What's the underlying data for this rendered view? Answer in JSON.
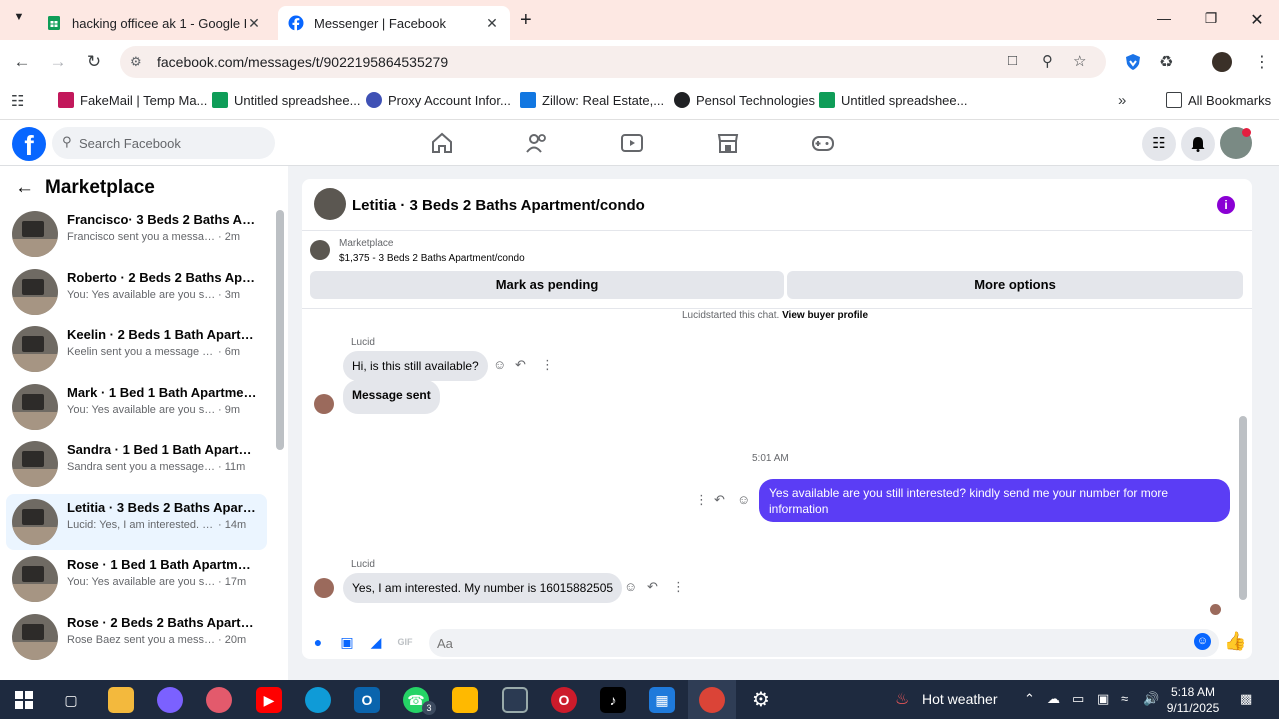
{
  "browser": {
    "tabs": [
      {
        "title": "hacking officee ak 1 - Google D",
        "icon": "sheets-icon",
        "active": false
      },
      {
        "title": "Messenger | Facebook",
        "icon": "facebook-icon",
        "active": true
      }
    ],
    "url": "facebook.com/messages/t/9022195864535279",
    "bookmarks": [
      {
        "label": "FakeMail | Temp Ma...",
        "icon": "fakemail-icon"
      },
      {
        "label": "Untitled spreadshee...",
        "icon": "sheets-icon"
      },
      {
        "label": "Proxy Account Infor...",
        "icon": "proxy-icon"
      },
      {
        "label": "Zillow: Real Estate,...",
        "icon": "zillow-icon"
      },
      {
        "label": "Pensol Technologies",
        "icon": "pensol-icon"
      },
      {
        "label": "Untitled spreadshee...",
        "icon": "sheets-icon"
      }
    ],
    "all_bookmarks": "All Bookmarks",
    "colors": {
      "tabbar": "#fde8e3",
      "sheets": "#0f9d58",
      "facebook": "#0866ff"
    }
  },
  "fb": {
    "search_placeholder": "Search Facebook",
    "nav_icons": [
      "home-icon",
      "friends-icon",
      "video-icon",
      "marketplace-icon",
      "gaming-icon"
    ]
  },
  "sidebar": {
    "title": "Marketplace",
    "conversations": [
      {
        "title": "Francisco· 3 Beds 2 Baths Apart...",
        "preview": "Francisco sent you a message abo...",
        "time": "· 2m",
        "selected": false
      },
      {
        "title": "Roberto · 2 Beds 2 Baths Apart...",
        "preview": "You: Yes available are you still inte...",
        "time": "· 3m",
        "selected": false
      },
      {
        "title": "Keelin · 2 Beds 1 Bath Apartmen...",
        "preview": "Keelin sent you a message about ...",
        "time": "· 6m",
        "selected": false
      },
      {
        "title": "Mark · 1 Bed 1 Bath Apartment/...",
        "preview": "You: Yes available are you still inte...",
        "time": "· 9m",
        "selected": false
      },
      {
        "title": "Sandra · 1 Bed 1 Bath Apartmen...",
        "preview": "Sandra sent you a message abou...",
        "time": "· 11m",
        "selected": false
      },
      {
        "title": "Letitia · 3 Beds 2 Baths Apartme...",
        "preview": "Lucid: Yes, I am interested. My n...",
        "time": "· 14m",
        "selected": true
      },
      {
        "title": "Rose · 1 Bed 1 Bath Apartment/c...",
        "preview": "You: Yes available are you still int...",
        "time": "· 17m",
        "selected": false
      },
      {
        "title": "Rose · 2 Beds 2 Baths Apartmen...",
        "preview": "Rose Baez sent you a message a...",
        "time": "· 20m",
        "selected": false
      }
    ]
  },
  "chat": {
    "title": "Letitia · 3 Beds 2 Baths Apartment/condo",
    "listing_source": "Marketplace",
    "listing_desc": "$1,375 - 3 Beds 2 Baths Apartment/condo",
    "btn_pending": "Mark as pending",
    "btn_more": "More options",
    "started_name": "Lucid",
    "started_text": "started this chat.",
    "started_link": "View buyer profile",
    "messages": [
      {
        "sender": "Lucid",
        "text": "Hi, is this still available?"
      },
      {
        "text": "Message sent"
      },
      {
        "time": "5:01 AM"
      },
      {
        "text": "Yes available are you still interested? kindly send me your number for more information"
      },
      {
        "sender": "Lucid",
        "text": "Yes, I am interested. My number is 16015882505"
      }
    ],
    "composer_placeholder": "Aa",
    "accent": "#5b3df5"
  },
  "taskbar": {
    "weather": "Hot weather",
    "time": "5:18 AM",
    "date": "9/11/2025",
    "whatsapp_badge": "3"
  }
}
